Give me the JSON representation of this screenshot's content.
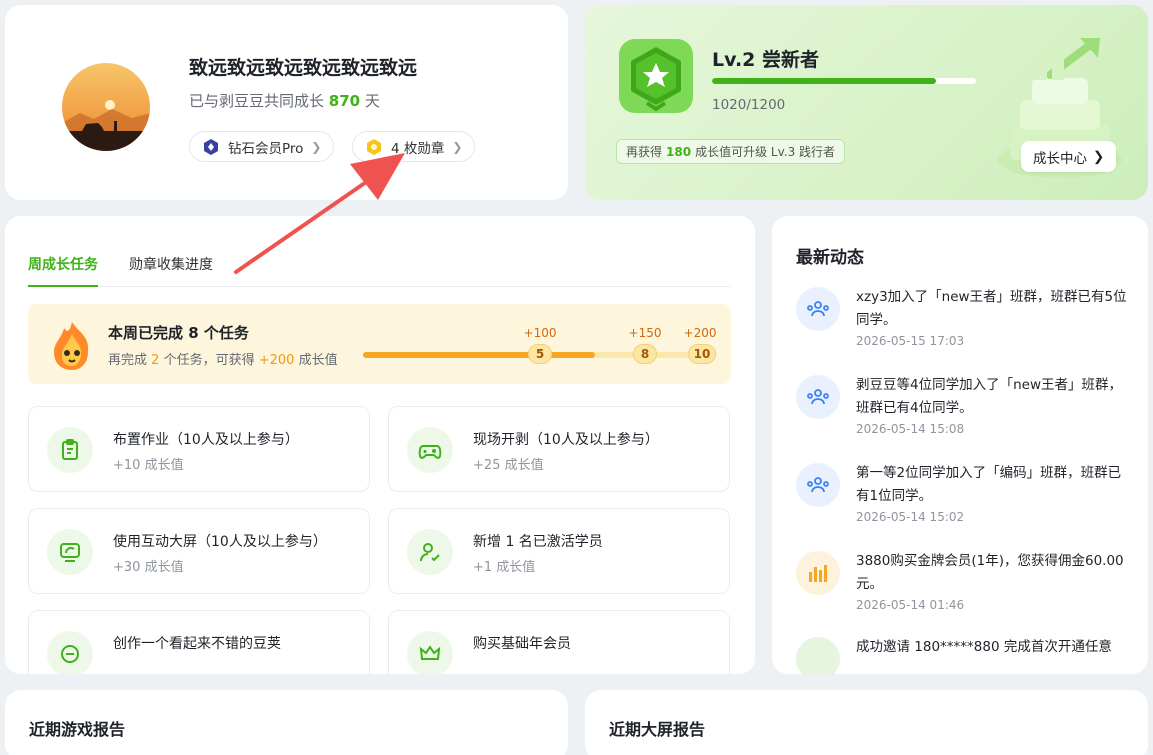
{
  "profile": {
    "username": "致远致远致远致远致远致远",
    "days_prefix": "已与剥豆豆共同成长",
    "days": "870",
    "days_suffix": "天",
    "member_label": "钻石会员Pro",
    "badges_label": "4 枚勋章"
  },
  "level": {
    "title": "Lv.2 尝新者",
    "progress": 0.85,
    "score": "1020/1200",
    "note_prefix": "再获得",
    "note_value": "180",
    "note_suffix": "成长值可升级 Lv.3 践行者",
    "center_button": "成长中心"
  },
  "tasks": {
    "tabs": [
      "周成长任务",
      "勋章收集进度"
    ],
    "active_tab": 0,
    "summary_title": "本周已完成 8 个任务",
    "summary_sub_1": "再完成",
    "summary_sub_count": "2",
    "summary_sub_2": "个任务，可获得",
    "summary_sub_value": "+200",
    "summary_sub_3": "成长值",
    "milestones": [
      {
        "node": "5",
        "bonus": "+100"
      },
      {
        "node": "8",
        "bonus": "+150"
      },
      {
        "node": "10",
        "bonus": "+200"
      }
    ],
    "completed": 8,
    "total": 10,
    "items": [
      {
        "title": "布置作业（10人及以上参与）",
        "value": "+10 成长值",
        "icon": "clipboard-icon"
      },
      {
        "title": "现场开剥（10人及以上参与）",
        "value": "+25 成长值",
        "icon": "gamepad-icon"
      },
      {
        "title": "使用互动大屏（10人及以上参与）",
        "value": "+30 成长值",
        "icon": "screen-icon"
      },
      {
        "title": "新增 1 名已激活学员",
        "value": "+1 成长值",
        "icon": "user-check-icon"
      },
      {
        "title": "创作一个看起来不错的豆荚",
        "value": "",
        "icon": "create-icon"
      },
      {
        "title": "购买基础年会员",
        "value": "",
        "icon": "crown-icon"
      }
    ]
  },
  "feed": {
    "title": "最新动态",
    "items": [
      {
        "text": "xzy3加入了「new王者」班群，班群已有5位同学。",
        "time": "2026-05-15 17:03",
        "icon": "group-icon"
      },
      {
        "text": "剥豆豆等4位同学加入了「new王者」班群，班群已有4位同学。",
        "time": "2026-05-14 15:08",
        "icon": "group-icon"
      },
      {
        "text": "第一等2位同学加入了「编码」班群，班群已有1位同学。",
        "time": "2026-05-14 15:02",
        "icon": "group-icon"
      },
      {
        "text": "3880购买金牌会员(1年)，您获得佣金60.00元。",
        "time": "2026-05-14 01:46",
        "icon": "bar-chart-icon"
      },
      {
        "text": "成功邀请 180*****880 完成首次开通任意",
        "time": "",
        "icon": "invite-icon"
      }
    ]
  },
  "bottom": {
    "games_title": "近期游戏报告",
    "screen_title": "近期大屏报告"
  },
  "colors": {
    "accent": "#3fb21a",
    "orange": "#f5a623",
    "annotation_arrow": "#f0524f"
  }
}
